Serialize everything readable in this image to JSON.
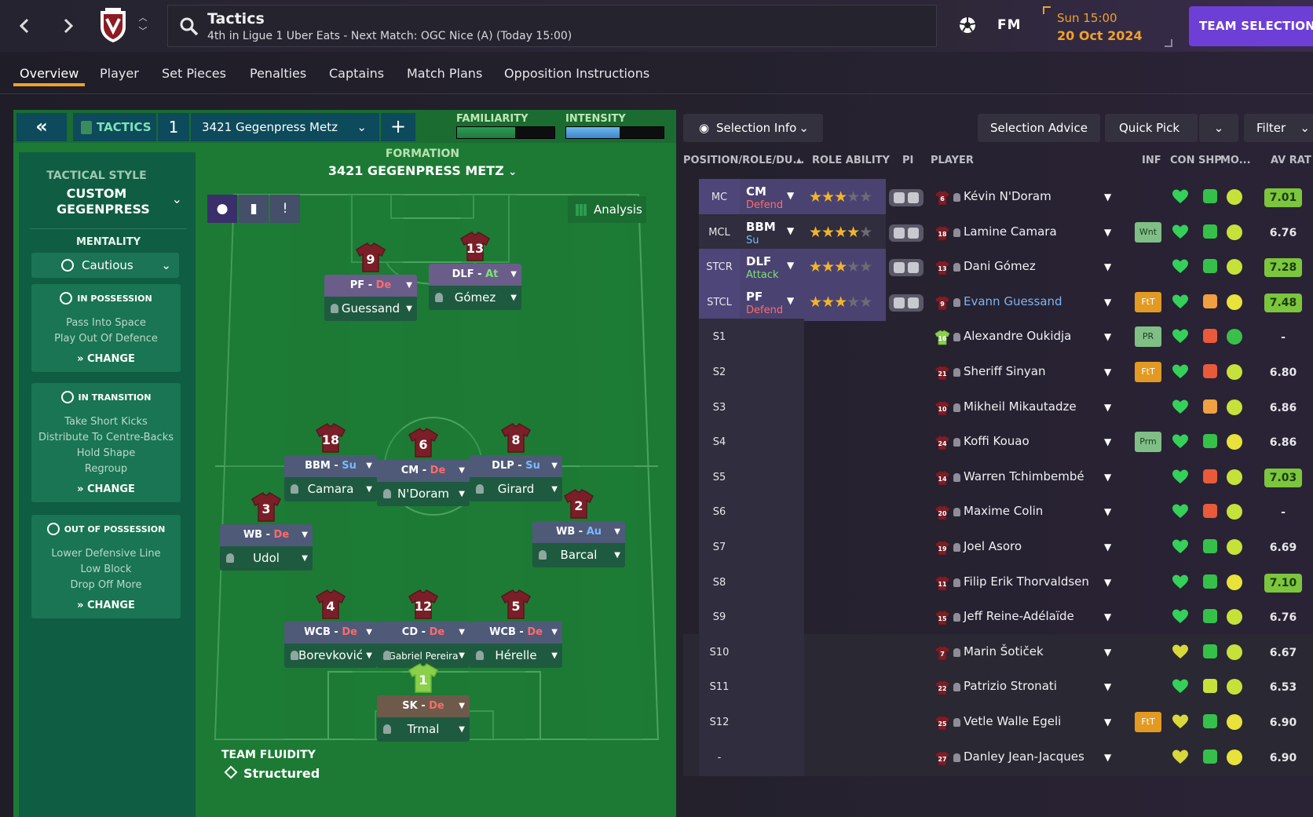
{
  "topbar": {
    "title": "Tactics",
    "subtitle": "4th in Ligue 1 Uber Eats - Next Match: OGC Nice (A) (Today 15:00)",
    "fm_logo": "FM",
    "date_line1": "Sun 15:00",
    "date_line2": "20 Oct 2024",
    "team_selection": "TEAM SELECTION",
    "back_icon": "chevron-left-icon",
    "forward_icon": "chevron-right-icon"
  },
  "tabs": [
    "Overview",
    "Player",
    "Set Pieces",
    "Penalties",
    "Captains",
    "Match Plans",
    "Opposition Instructions"
  ],
  "tactic": {
    "label": "TACTICS",
    "number": "1",
    "name": "3421 Gegenpress Metz",
    "familiarity_label": "FAMILIARITY",
    "familiarity_level": 0.6,
    "intensity_label": "INTENSITY",
    "intensity_level": 0.55,
    "style_label": "TACTICAL STYLE",
    "style_value": "CUSTOM GEGENPRESS",
    "mentality_label": "MENTALITY",
    "mentality_value": "Cautious",
    "in_possession": {
      "title": "IN POSSESSION",
      "lines": [
        "Pass Into Space",
        "Play Out Of Defence"
      ],
      "change": "CHANGE"
    },
    "in_transition": {
      "title": "IN TRANSITION",
      "lines": [
        "Take Short Kicks",
        "Distribute To Centre-Backs",
        "Hold Shape",
        "Regroup"
      ],
      "change": "CHANGE"
    },
    "out_of_possession": {
      "title": "OUT OF POSSESSION",
      "lines": [
        "Lower Defensive Line",
        "Low Block",
        "Drop Off More"
      ],
      "change": "CHANGE"
    },
    "formation_label": "FORMATION",
    "formation_name": "3421 GEGENPRESS METZ",
    "analysis": "Analysis",
    "fluidity_label": "TEAM FLUIDITY",
    "fluidity_value": "Structured"
  },
  "pitch_players": [
    {
      "num": "9",
      "role": "PF",
      "duty": "De",
      "name": "Guessand",
      "duty_color": "#ff6b6b",
      "role_bg": "#6a5d8a"
    },
    {
      "num": "13",
      "role": "DLF",
      "duty": "At",
      "name": "Gómez",
      "duty_color": "#7ee07a",
      "role_bg": "#6a5d8a"
    },
    {
      "num": "18",
      "role": "BBM",
      "duty": "Su",
      "name": "Camara",
      "duty_color": "#7ab8ff",
      "role_bg": "#4e5a78"
    },
    {
      "num": "6",
      "role": "CM",
      "duty": "De",
      "name": "N'Doram",
      "duty_color": "#ff6b6b",
      "role_bg": "#4e5a78"
    },
    {
      "num": "8",
      "role": "DLP",
      "duty": "Su",
      "name": "Girard",
      "duty_color": "#7ab8ff",
      "role_bg": "#4e5a78"
    },
    {
      "num": "3",
      "role": "WB",
      "duty": "De",
      "name": "Udol",
      "duty_color": "#ff6b6b",
      "role_bg": "#4e5a78"
    },
    {
      "num": "2",
      "role": "WB",
      "duty": "Au",
      "name": "Barcal",
      "duty_color": "#7ab8ff",
      "role_bg": "#4e5a78"
    },
    {
      "num": "4",
      "role": "WCB",
      "duty": "De",
      "name": "Borevković",
      "duty_color": "#ff6b6b",
      "role_bg": "#4e5a78"
    },
    {
      "num": "12",
      "role": "CD",
      "duty": "De",
      "name": "Gabriel Pereira",
      "duty_color": "#ff6b6b",
      "role_bg": "#4e5a78"
    },
    {
      "num": "5",
      "role": "WCB",
      "duty": "De",
      "name": "Hérelle",
      "duty_color": "#ff6b6b",
      "role_bg": "#4e5a78"
    },
    {
      "num": "1",
      "role": "SK",
      "duty": "De",
      "name": "Trmal",
      "duty_color": "#ff6b6b",
      "role_bg": "#6d5a4a",
      "gk": true
    }
  ],
  "right_controls": {
    "selection_info": "Selection Info",
    "selection_advice": "Selection Advice",
    "quick_pick": "Quick Pick",
    "filter": "Filter"
  },
  "table_headers": {
    "position": "POSITION/ROLE/DU...",
    "role_ability": "ROLE ABILITY",
    "pi": "PI",
    "player": "PLAYER",
    "inf": "INF",
    "con": "CON",
    "shp": "SHP",
    "mo": "MO...",
    "av_rat": "AV RAT"
  },
  "rows": [
    {
      "pos": "MC",
      "role": "CM",
      "duty": "Defend",
      "duty_color": "#ff6b6b",
      "stars": 3,
      "num": "6",
      "player": "Kévin N'Doram",
      "inf": "",
      "rating": "7.01",
      "good": true,
      "sel": true,
      "shp": "#35c04a",
      "mo": "#c6e23a"
    },
    {
      "pos": "MCL",
      "role": "BBM",
      "duty": "Su",
      "duty_color": "#7ab8ff",
      "stars": 4,
      "num": "18",
      "player": "Lamine Camara",
      "inf": "Wnt",
      "inf_bg": "#7fbf86",
      "rating": "6.76",
      "good": false,
      "sel": false,
      "shp": "#35c04a",
      "mo": "#c6e23a"
    },
    {
      "pos": "STCR",
      "role": "DLF",
      "duty": "Attack",
      "duty_color": "#7ee07a",
      "stars": 3,
      "num": "13",
      "player": "Dani Gómez",
      "inf": "",
      "rating": "7.28",
      "good": true,
      "sel": true,
      "shp": "#35c04a",
      "mo": "#c6e23a"
    },
    {
      "pos": "STCL",
      "role": "PF",
      "duty": "Defend",
      "duty_color": "#ff6b6b",
      "stars": 3,
      "num": "9",
      "player": "Evann Guessand",
      "inf": "FtT",
      "inf_bg": "#e29a22",
      "rating": "7.48",
      "good": true,
      "sel": true,
      "link": true,
      "shp": "#f0a040",
      "mo": "#e8e23a"
    },
    {
      "pos": "S1",
      "num": "16",
      "player": "Alexandre Oukidja",
      "inf": "PR",
      "inf_bg": "#7fbf86",
      "rating": "-",
      "gk": true,
      "shp": "#e85a3a",
      "mo": "#3ac04a"
    },
    {
      "pos": "S2",
      "num": "21",
      "player": "Sheriff Sinyan",
      "inf": "FtT",
      "inf_bg": "#e29a22",
      "rating": "6.80",
      "shp": "#e85a3a",
      "mo": "#c6e23a"
    },
    {
      "pos": "S3",
      "num": "10",
      "player": "Mikheil Mikautadze",
      "inf": "",
      "rating": "6.86",
      "shp": "#f0a040",
      "mo": "#c6e23a"
    },
    {
      "pos": "S4",
      "num": "24",
      "player": "Koffi Kouao",
      "inf": "Prm",
      "inf_bg": "#7fbf86",
      "rating": "6.86",
      "shp": "#35c04a",
      "mo": "#e8e23a"
    },
    {
      "pos": "S5",
      "num": "14",
      "player": "Warren Tchimbembé",
      "inf": "",
      "rating": "7.03",
      "good": true,
      "shp": "#e85a3a",
      "mo": "#c6e23a"
    },
    {
      "pos": "S6",
      "num": "20",
      "player": "Maxime Colin",
      "inf": "",
      "rating": "-",
      "shp": "#e85a3a",
      "mo": "#c6e23a"
    },
    {
      "pos": "S7",
      "num": "19",
      "player": "Joel Asoro",
      "inf": "",
      "rating": "6.69",
      "shp": "#35c04a",
      "mo": "#c6e23a"
    },
    {
      "pos": "S8",
      "num": "11",
      "player": "Filip Erik Thorvaldsen",
      "inf": "",
      "rating": "7.10",
      "good": true,
      "shp": "#35c04a",
      "mo": "#e8e23a"
    },
    {
      "pos": "S9",
      "num": "15",
      "player": "Jeff Reine-Adélaïde",
      "inf": "",
      "rating": "6.76",
      "shp": "#35c04a",
      "mo": "#c6e23a"
    },
    {
      "pos": "S10",
      "num": "7",
      "player": "Marin Šotiček",
      "inf": "",
      "rating": "6.67",
      "shp": "#35c04a",
      "mo": "#c6e23a",
      "yheart": true,
      "hl": true
    },
    {
      "pos": "S11",
      "num": "22",
      "player": "Patrizio Stronati",
      "inf": "",
      "rating": "6.53",
      "shp": "#c6e23a",
      "mo": "#c6e23a",
      "hl": true
    },
    {
      "pos": "S12",
      "num": "25",
      "player": "Vetle Walle Egeli",
      "inf": "FtT",
      "inf_bg": "#e29a22",
      "rating": "6.90",
      "shp": "#35c04a",
      "mo": "#e8e23a",
      "yheart": true,
      "hl": true
    },
    {
      "pos": "-",
      "num": "27",
      "player": "Danley Jean-Jacques",
      "inf": "",
      "rating": "6.90",
      "shp": "#35c04a",
      "mo": "#e8e23a",
      "yheart": true,
      "hl": true
    }
  ]
}
